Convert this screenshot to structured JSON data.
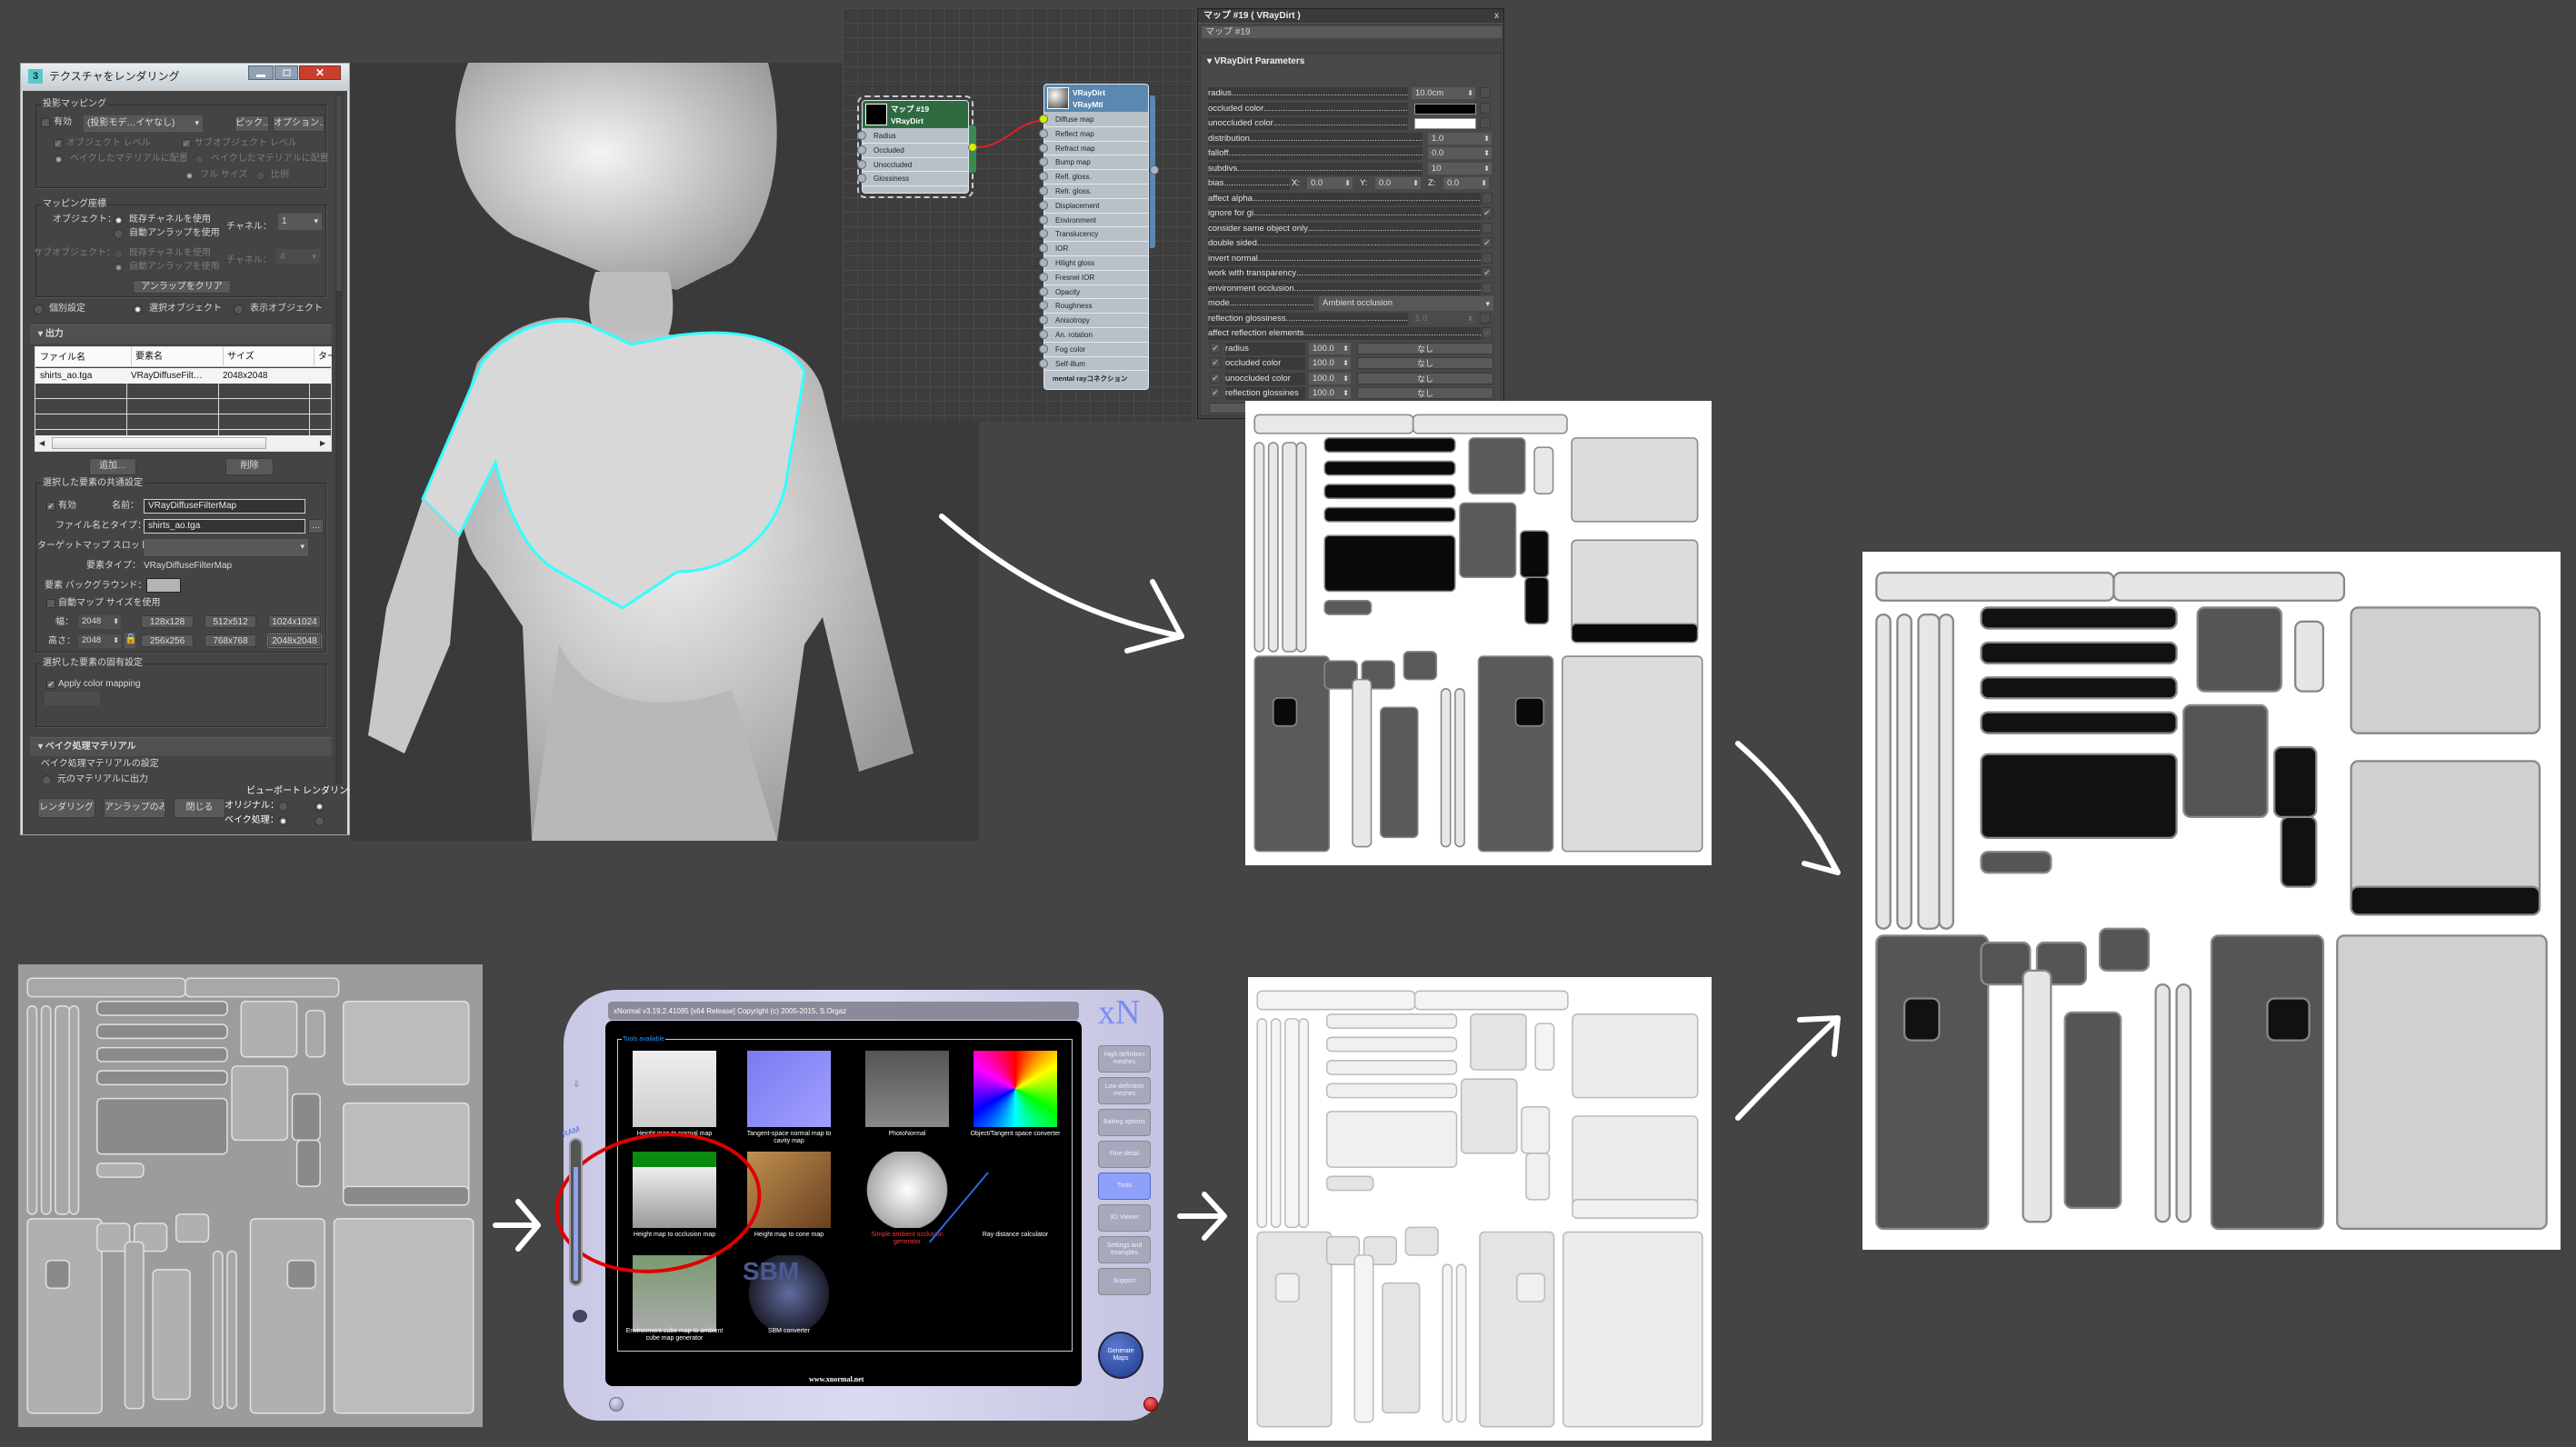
{
  "dialog": {
    "title": "テクスチャをレンダリング",
    "projection_group": "投影マッピング",
    "enable": "有効",
    "projection_dropdown": "(投影モデ…イヤなし)",
    "pick_button": "ピック…",
    "options_button": "オプション…",
    "object_level": "オブジェクト レベル",
    "subobject_level": "サブオブジェクト レベル",
    "put_to_baked_1": "ベイクしたマテリアルに配置",
    "put_to_baked_2": "ベイクしたマテリアルに配置",
    "full_size": "フル サイズ",
    "proportional": "比例",
    "mapping_group": "マッピング座標",
    "object_label": "オブジェクト：",
    "use_existing_channel": "既存チャネルを使用",
    "use_auto_unwrap": "自動アンラップを使用",
    "channel_label": "チャネル：",
    "channel_value": "1",
    "subobject_label": "サブオブジェクト：",
    "sub_use_existing": "既存チャネルを使用",
    "sub_use_auto": "自動アンラップを使用",
    "sub_channel_label": "チャネル：",
    "sub_channel_value": "4",
    "clear_unwrap": "アンラップをクリア",
    "individual": "個別設定",
    "selected_objects": "選択オブジェクト",
    "visible_objects": "表示オブジェクト",
    "output_header": "出力",
    "table": {
      "columns": [
        "ファイル名",
        "要素名",
        "サイズ",
        "ター"
      ],
      "rows": [
        [
          "shirts_ao.tga",
          "VRayDiffuseFilt…",
          "2048x2048",
          ""
        ]
      ]
    },
    "add_button": "追加…",
    "delete_button": "削除",
    "common_group": "選択した要素の共通設定",
    "common_enable": "有効",
    "name_label": "名前：",
    "name_value": "VRayDiffuseFilterMap",
    "filename_label": "ファイル名とタイプ：",
    "filename_value": "shirts_ao.tga",
    "browse_button": "…",
    "target_slot_label": "ターゲットマップ スロット：",
    "element_type_label": "要素タイプ：",
    "element_type_value": "VRayDiffuseFilterMap",
    "element_bg_label": "要素 バックグラウンド：",
    "element_bg_color": "#b4b4b4",
    "auto_map_size": "自動マップ サイズを使用",
    "width_label": "幅：",
    "width_value": "2048",
    "height_label": "高さ：",
    "height_value": "2048",
    "size_presets": [
      "128x128",
      "512x512",
      "1024x1024",
      "256x256",
      "768x768",
      "2048x2048"
    ],
    "specific_group": "選択した要素の固有設定",
    "apply_color_mapping": "Apply color mapping",
    "baked_material_header": "ベイク処理マテリアル",
    "baked_material_group": "ベイク処理マテリアルの設定",
    "output_to_source": "元のマテリアルに出力",
    "render_button": "レンダリング",
    "unwrap_only_button": "アンラップのみ",
    "close_button": "閉じる",
    "viewport_label": "ビューポート",
    "rendering_label": "レンダリング",
    "original_label": "オリジナル：",
    "baked_label": "ベイク処理："
  },
  "node_editor": {
    "map_node": {
      "title1": "マップ #19",
      "title2": "VRayDirt",
      "inputs": [
        "Radius",
        "Occluded",
        "Unoccluded",
        "Glossiness"
      ]
    },
    "mtl_node": {
      "title1": "VRayDirt",
      "title2": "VRayMtl",
      "inputs": [
        "Diffuse map",
        "Reflect map",
        "Refract map",
        "Bump map",
        "Refl. gloss.",
        "Refr. gloss.",
        "Displacement",
        "Environment",
        "Translucency",
        "IOR",
        "Hilight gloss",
        "Fresnel IOR",
        "Opacity",
        "Roughness",
        "Anisotropy",
        "An. rotation",
        "Fog color",
        "Self-illum"
      ],
      "footer": "mental rayコネクション"
    },
    "wire_color": "#e02020",
    "connected_socket_color": "#d4f000"
  },
  "vray_panel": {
    "title": "マップ #19 ( VRayDirt )",
    "map_name": "マップ #19",
    "rollout": "VRayDirt Parameters",
    "rows": [
      {
        "label": "radius",
        "type": "spin",
        "value": "10.0cm",
        "map": true
      },
      {
        "label": "occluded color",
        "type": "color",
        "value": "#000000",
        "map": true
      },
      {
        "label": "unoccluded color",
        "type": "color",
        "value": "#ffffff",
        "map": true
      },
      {
        "label": "distribution",
        "type": "spin2",
        "value": "1.0"
      },
      {
        "label": "falloff",
        "type": "spin2",
        "value": "0.0"
      },
      {
        "label": "subdivs",
        "type": "spin2",
        "value": "10"
      },
      {
        "label": "bias",
        "type": "xyz",
        "x": "0.0",
        "y": "0.0",
        "z": "0.0"
      },
      {
        "label": "affect alpha",
        "type": "check",
        "checked": false
      },
      {
        "label": "ignore for gi",
        "type": "check",
        "checked": true
      },
      {
        "label": "consider same object only",
        "type": "check",
        "checked": false
      },
      {
        "label": "double sided",
        "type": "check",
        "checked": true
      },
      {
        "label": "invert normal",
        "type": "check",
        "checked": false
      },
      {
        "label": "work with transparency",
        "type": "check",
        "checked": true
      },
      {
        "label": "environment occlusion",
        "type": "check",
        "checked": false
      },
      {
        "label": "mode",
        "type": "dropdown",
        "value": "Ambient occlusion"
      },
      {
        "label": "reflection glossiness",
        "type": "spin",
        "value": "1.0",
        "map": true,
        "disabled": true
      },
      {
        "label": "affect reflection elements",
        "type": "check",
        "checked": true,
        "disabled": true
      }
    ],
    "maps": [
      {
        "label": "radius",
        "amount": "100.0",
        "map": "なし"
      },
      {
        "label": "occluded color",
        "amount": "100.0",
        "map": "なし"
      },
      {
        "label": "unoccluded color",
        "amount": "100.0",
        "map": "なし"
      },
      {
        "label": "reflection glossines",
        "amount": "100.0",
        "map": "なし"
      }
    ],
    "exclude_button": "Exclude..."
  },
  "xnormal": {
    "title": "xNormal v3.19.2.41085 [x64 Release] Copyright (c) 2005-2015, S.Orgaz",
    "logo": "xN",
    "ram_label": "RAM",
    "tools_label": "Tools available",
    "tools": [
      "Height map to normal map",
      "Tangent-space normal map to cavity map",
      "PhotoNormal",
      "Object/Tangent space converter",
      "Height map to occlusion map",
      "Height map to cone map",
      "Simple ambient occlusion generator",
      "Ray distance calculator",
      "Environment cube map to ambient cube map generator",
      "SBM converter"
    ],
    "sbm_logo": "SBM",
    "nav_buttons": [
      "High definition meshes",
      "Low definition meshes",
      "Baking options",
      "Fine detail",
      "Tools",
      "3D Viewer",
      "Settings and examples",
      "Support"
    ],
    "active_nav": "Tools",
    "generate_button": "Generate Maps",
    "website": "www.xnormal.net",
    "highlight_color": "#e00000"
  }
}
